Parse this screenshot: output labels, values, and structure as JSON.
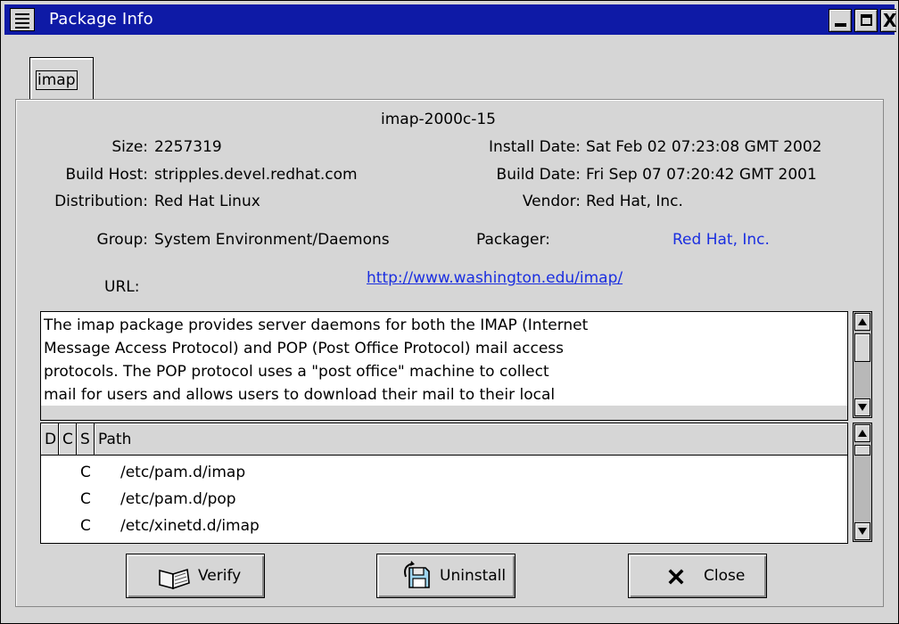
{
  "window": {
    "title": "Package Info",
    "close_glyph": "X"
  },
  "tab": {
    "label": "imap"
  },
  "package": {
    "name": "imap-2000c-15",
    "size_label": "Size:",
    "size_value": "2257319",
    "install_date_label": "Install Date:",
    "install_date_value": "Sat Feb 02 07:23:08 GMT 2002",
    "build_host_label": "Build Host:",
    "build_host_value": "stripples.devel.redhat.com",
    "build_date_label": "Build Date:",
    "build_date_value": "Fri Sep 07 07:20:42 GMT 2001",
    "distribution_label": "Distribution:",
    "distribution_value": "Red Hat Linux",
    "vendor_label": "Vendor:",
    "vendor_value": "Red Hat, Inc.",
    "group_label": "Group:",
    "group_value": "System Environment/Daemons",
    "packager_label": "Packager:",
    "packager_value": "Red Hat, Inc.",
    "url_label": "URL:",
    "url_value": "http://www.washington.edu/imap/"
  },
  "description": "The imap package provides server daemons for both the IMAP (Internet\nMessage Access Protocol) and POP (Post Office Protocol) mail access\nprotocols. The POP protocol uses a \"post office\" machine to collect\nmail for users and allows users to download their mail to their local\nmachine for reading. The IMAP protocol allows a user to read mail",
  "file_list": {
    "columns": [
      "D",
      "C",
      "S",
      "Path"
    ],
    "rows": [
      {
        "d": "",
        "c": "C",
        "s": "",
        "path": "/etc/pam.d/imap"
      },
      {
        "d": "",
        "c": "C",
        "s": "",
        "path": "/etc/pam.d/pop"
      },
      {
        "d": "",
        "c": "C",
        "s": "",
        "path": "/etc/xinetd.d/imap"
      }
    ]
  },
  "buttons": {
    "verify": "Verify",
    "uninstall": "Uninstall",
    "close": "Close"
  },
  "colors": {
    "titlebar": "#0e1aa6",
    "link": "#1a2ee0",
    "window_bg": "#d6d6d6"
  }
}
